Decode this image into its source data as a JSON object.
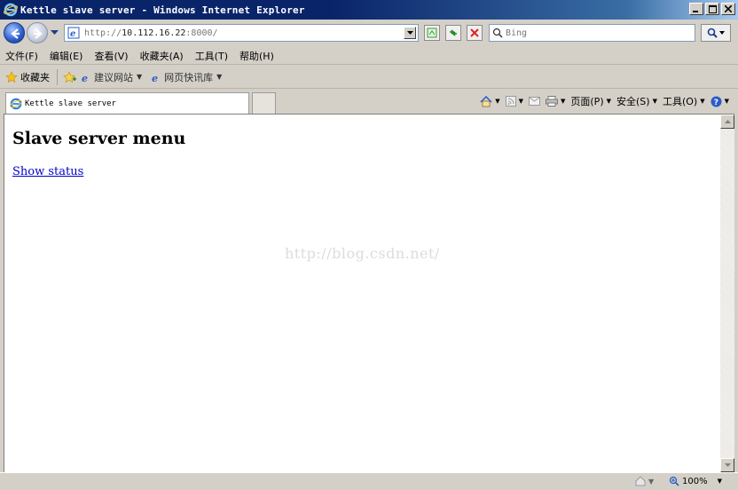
{
  "window": {
    "title": "Kettle slave server - Windows Internet Explorer"
  },
  "address": {
    "prefix": "http://",
    "host": "10.112.16.22",
    "suffix": ":8000/"
  },
  "search": {
    "placeholder": "Bing"
  },
  "menu": [
    {
      "label": "文件(F)"
    },
    {
      "label": "编辑(E)"
    },
    {
      "label": "查看(V)"
    },
    {
      "label": "收藏夹(A)"
    },
    {
      "label": "工具(T)"
    },
    {
      "label": "帮助(H)"
    }
  ],
  "favorites": {
    "label": "收藏夹",
    "links": [
      {
        "label": "建议网站"
      },
      {
        "label": "网页快讯库"
      }
    ]
  },
  "tab": {
    "title": "Kettle slave server"
  },
  "commands": {
    "page": "页面(P)",
    "safety": "安全(S)",
    "tools": "工具(O)"
  },
  "content": {
    "heading": "Slave server menu",
    "link": "Show status",
    "watermark": "http://blog.csdn.net/"
  },
  "status": {
    "zoom": "100%"
  },
  "colors": {
    "titlebar": "#0a246a",
    "link": "#0000cc",
    "chrome": "#d4d0c8"
  }
}
